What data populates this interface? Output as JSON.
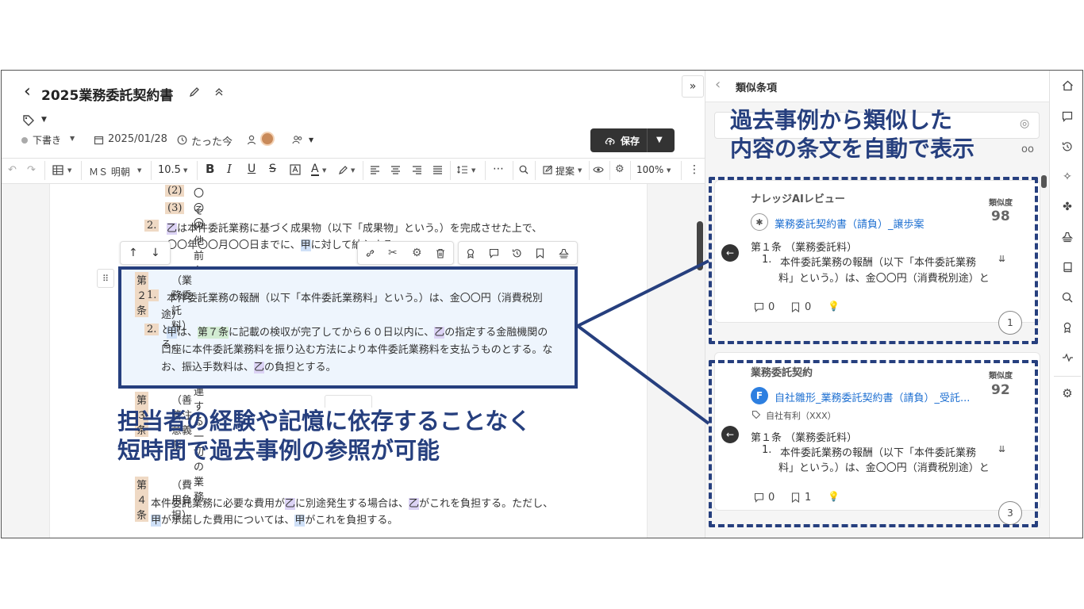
{
  "header": {
    "back_glyph": "‹",
    "title": "2025業務委託契約書",
    "status": "下書き",
    "date": "2025/01/28",
    "updated": "たった今",
    "save_label": "保存"
  },
  "toolbar": {
    "font": "ＭＳ 明朝",
    "size": "10.5",
    "suggest": "提案",
    "zoom": "100%"
  },
  "doc": {
    "item2": "(2)",
    "item2_text": "〇〇〇",
    "item3": "(3)",
    "item3_text": "その他前各号に付帯又は関連する一切の業務",
    "p2_num": "2.",
    "p2_o": "乙",
    "p2_a": "は本件委託業務に基づく成果物（以下「成果物」という。）を完成させた上で、",
    "p2_b": "〇〇年〇〇月〇〇日までに、",
    "p2_k": "甲",
    "p2_c": "に対して納入する。",
    "art2_num": "第２条",
    "art2_title": "（業務委託料）",
    "a2p1_num": "1.",
    "a2p1_a": "本件委託業務の報酬（以下「本件委託業務料」という。）は、金〇〇円（消費税別",
    "a2p1_b": "途）とする。",
    "a2p2_num": "2.",
    "a2p2_k": "甲",
    "a2p2_a": "は、",
    "a2p2_g": "第７条",
    "a2p2_b": "に記載の検収が完了してから６０日以内に、",
    "a2p2_o": "乙",
    "a2p2_c": "の指定する金融機関の",
    "a2p2_d": "口座に本件委託業務料を振り込む方法により本件委託業務料を支払うものとする。な",
    "a2p2_e": "お、振込手数料は、",
    "a2p2_o2": "乙",
    "a2p2_f": "の負担とする。",
    "art3_num": "第３条",
    "art3_title": "（善管注意義務）",
    "art4_num": "第４条",
    "art4_title": "（費用負担）",
    "a4_a": "本件委託業務に必要な費用が",
    "a4_o": "乙",
    "a4_b": "に別途発生する場合は、",
    "a4_o2": "乙",
    "a4_c": "がこれを負担する。ただし、",
    "a4_k": "甲",
    "a4_d": "が承諾した費用については、",
    "a4_k2": "甲",
    "a4_e": "がこれを負担する。"
  },
  "overlay": {
    "left_line1": "担当者の経験や記憶に依存することなく",
    "left_line2": "短時間で過去事例の参照が可能",
    "right_line1": "過去事例から類似した",
    "right_line2": "内容の条文を自動で表示"
  },
  "panel": {
    "title": "類似条項",
    "cards": [
      {
        "category": "ナレッジAIレビュー",
        "sim_label": "類似度",
        "sim_value": "98",
        "doc_link": "業務委託契約書（請負）_譲歩案",
        "clause_title": "第１条 （業務委託料）",
        "item_num": "1.",
        "item_line1": "本件委託業務の報酬（以下「本件委託業務",
        "item_line2": "料」という。）は、金〇〇円（消費税別途）と",
        "comments": "0",
        "bookmarks": "0",
        "page": "1"
      },
      {
        "category": "業務委託契約",
        "sim_label": "類似度",
        "sim_value": "92",
        "avatar": "F",
        "doc_link": "自社雛形_業務委託契約書（請負）_受託...",
        "tag": "自社有利（XXX）",
        "clause_title": "第１条 （業務委託料）",
        "item_num": "1.",
        "item_line1": "本件委託業務の報酬（以下「本件委託業務",
        "item_line2": "料」という。）は、金〇〇円（消費税別途）と",
        "comments": "0",
        "bookmarks": "1",
        "page": "3"
      }
    ]
  },
  "colors": {
    "accent": "#263f7e",
    "link": "#1d6fd1",
    "kou": "#efd9c4",
    "otsu": "#dcd3f5",
    "highlight_blue": "#cfe0f7",
    "green": "#d2ecd2",
    "save_bg": "#333333"
  },
  "icons": [
    "back-icon",
    "edit-icon",
    "collapse-icon",
    "tag-icon",
    "calendar-icon",
    "clock-icon",
    "user-icon",
    "team-icon",
    "upload-icon",
    "undo-icon",
    "redo-icon",
    "table-icon",
    "bold-icon",
    "italic-icon",
    "underline-icon",
    "strike-icon",
    "link-icon",
    "scissors-icon",
    "gear-icon",
    "trash-icon",
    "comment-icon",
    "history-icon",
    "bookmark-icon",
    "search-icon",
    "eye-icon",
    "home-icon",
    "sparkle-icon",
    "lightbulb-icon"
  ]
}
